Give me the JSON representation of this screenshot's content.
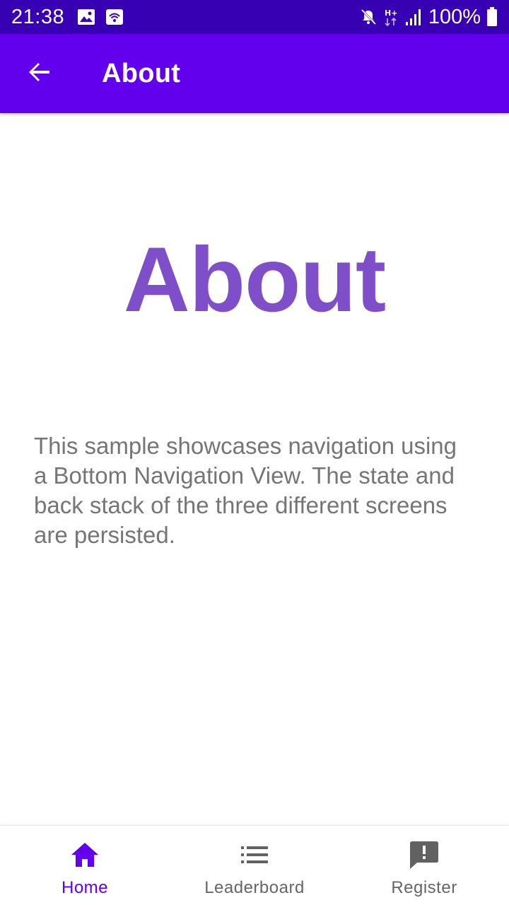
{
  "status_bar": {
    "time": "21:38",
    "battery_text": "100%",
    "icons": [
      "gallery-icon",
      "wifi-icon",
      "mute-icon",
      "network-h-plus-icon",
      "signal-icon",
      "battery-icon"
    ]
  },
  "app_bar": {
    "title": "About",
    "back_icon": "arrow-back-icon"
  },
  "main": {
    "hero_title": "About",
    "description": "This sample showcases navigation using a Bottom Navigation View. The state and back stack of the three different screens are persisted."
  },
  "bottom_nav": {
    "items": [
      {
        "label": "Home",
        "icon": "home-icon",
        "active": true
      },
      {
        "label": "Leaderboard",
        "icon": "list-icon",
        "active": false
      },
      {
        "label": "Register",
        "icon": "feedback-icon",
        "active": false
      }
    ]
  },
  "colors": {
    "status_bar": "#3700b3",
    "app_bar": "#6200ee",
    "hero_text": "#7e4fc8",
    "body_text": "#757575",
    "nav_active": "#6200ee",
    "nav_inactive": "#666666"
  }
}
